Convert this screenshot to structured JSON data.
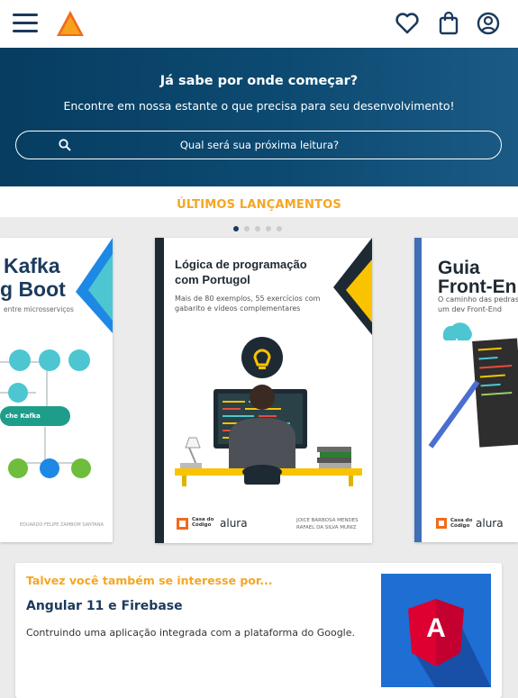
{
  "header": {
    "menu_icon": "hamburger-menu-icon",
    "logo_icon": "triangle-logo-icon",
    "actions": [
      "heart-icon",
      "shopping-bag-icon",
      "user-account-icon"
    ]
  },
  "hero": {
    "title": "Já sabe por onde começar?",
    "subtitle": "Encontre em nossa estante o que precisa para seu desenvolvimento!",
    "search_placeholder": "Qual será sua próxima leitura?"
  },
  "releases": {
    "heading": "ÚLTIMOS LANÇAMENTOS",
    "dots": 5,
    "active_dot": 1,
    "books": [
      {
        "title_line1": "Kafka",
        "title_line2": "g Boot",
        "subtitle": "entre microsserviços",
        "diagram_label": "che Kafka",
        "authors": "EDUARDO FELIPE ZAMBOM SANTANA"
      },
      {
        "title_line1": "Lógica de programação",
        "title_line2": "com Portugol",
        "subtitle_line1": "Mais de 80 exemplos, 55 exercícios com",
        "subtitle_line2": "gabarito e vídeos complementares",
        "author_line1": "JOICE BARBOSA MENDES",
        "author_line2": "RAFAEL DA SILVA MUNIZ",
        "publisher_line1": "Casa do",
        "publisher_line2": "Código",
        "partner": "alura"
      },
      {
        "title_line1": "Guia",
        "title_line2": "Front-En",
        "subtitle_line1": "O caminho das pedras pa",
        "subtitle_line2": "um dev Front-End",
        "publisher_line1": "Casa do",
        "publisher_line2": "Código",
        "partner": "alura"
      }
    ]
  },
  "suggestion": {
    "kicker": "Talvez você também se interesse por...",
    "title": "Angular 11 e Firebase",
    "description": "Contruindo uma aplicação integrada com a plataforma do Google.",
    "thumb_letter": "A"
  },
  "colors": {
    "navy": "#1b3a5c",
    "accent_orange": "#f5a623",
    "hero_bg": "#063d61",
    "angular_red": "#dd0031",
    "angular_blue": "#1f6ed4"
  }
}
